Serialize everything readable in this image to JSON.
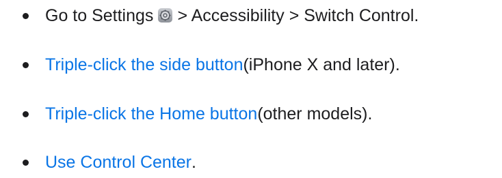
{
  "items": [
    {
      "prefix": "Go to Settings",
      "icon": "settings-gear-icon",
      "suffix": "> Accessibility > Switch Control."
    },
    {
      "link": "Triple-click the side button",
      "rest": " (iPhone X and later)."
    },
    {
      "link": "Triple-click the Home button",
      "rest": " (other models)."
    },
    {
      "link": "Use Control Center",
      "rest": "."
    }
  ],
  "colors": {
    "text": "#1d1d1f",
    "link": "#0a75e6"
  }
}
